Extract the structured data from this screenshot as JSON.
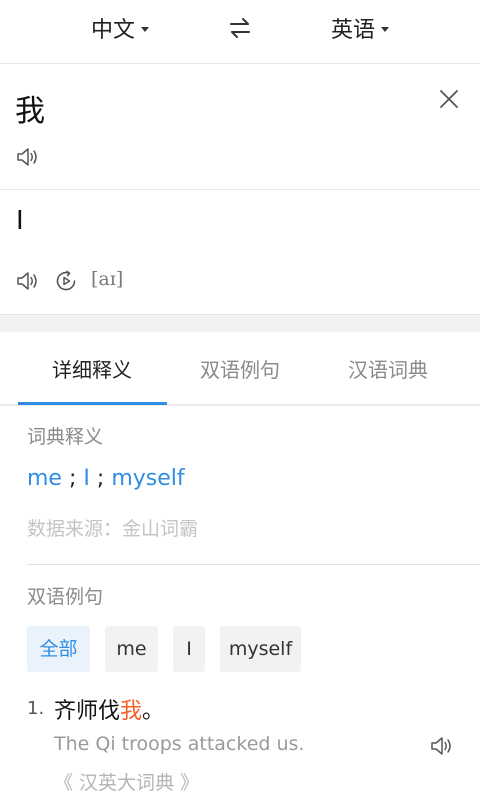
{
  "header": {
    "source_lang": "中文",
    "target_lang": "英语"
  },
  "input": {
    "text": "我"
  },
  "translation": {
    "text": "I",
    "phonetic": "[aɪ]"
  },
  "tabs": [
    {
      "label": "详细释义",
      "active": true
    },
    {
      "label": "双语例句",
      "active": false
    },
    {
      "label": "汉语词典",
      "active": false
    }
  ],
  "dictionary": {
    "title": "词典释义",
    "definitions": [
      "me",
      "I",
      "myself"
    ],
    "separator": ";",
    "source": "数据来源：金山词霸"
  },
  "examples": {
    "title": "双语例句",
    "filters": [
      {
        "label": "全部",
        "active": true
      },
      {
        "label": "me",
        "active": false
      },
      {
        "label": "I",
        "active": false
      },
      {
        "label": "myself",
        "active": false
      }
    ],
    "items": [
      {
        "number": "1.",
        "zh_before": "齐师伐",
        "zh_highlight": "我",
        "zh_after": "。",
        "en": "The Qi troops attacked us.",
        "source": "《 汉英大词典 》"
      }
    ]
  },
  "colors": {
    "accent": "#2f8de4",
    "highlight": "#f2632a"
  }
}
